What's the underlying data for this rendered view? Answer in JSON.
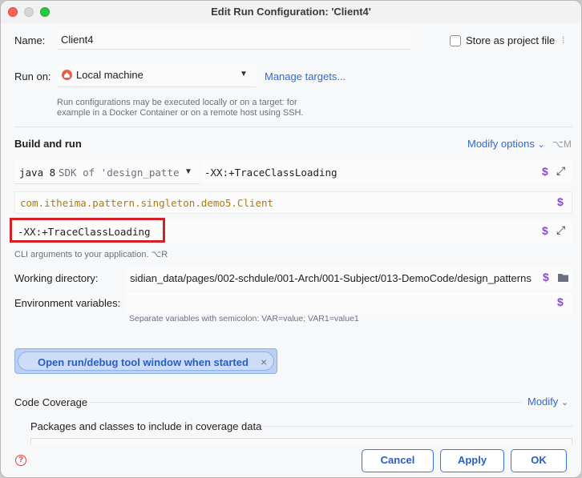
{
  "window": {
    "title": "Edit Run Configuration: 'Client4'"
  },
  "name_row": {
    "label": "Name:",
    "value": "Client4",
    "store_label": "Store as project file"
  },
  "run_on": {
    "label": "Run on:",
    "value": "Local machine",
    "manage_link": "Manage targets...",
    "help_line1": "Run configurations may be executed locally or on a target: for",
    "help_line2": "example in a Docker Container or on a remote host using SSH."
  },
  "build": {
    "heading": "Build and run",
    "modify_options": "Modify options",
    "modify_shortcut": "⌥M",
    "jdk_java": "java 8",
    "jdk_sdk": "SDK of 'design_pattern",
    "vm_options": "-XX:+TraceClassLoading",
    "main_class": "com.itheima.pattern.singleton.demo5.Client",
    "program_args": "-XX:+TraceClassLoading",
    "cli_hint": "CLI arguments to your application. ⌥R"
  },
  "working_dir": {
    "label": "Working directory:",
    "value": "sidian_data/pages/002-schdule/001-Arch/001-Subject/013-DemoCode/design_patterns"
  },
  "env": {
    "label": "Environment variables:",
    "hint": "Separate variables with semicolon: VAR=value; VAR1=value1"
  },
  "open_tool_window": {
    "label": "Open run/debug tool window when started",
    "close": "×"
  },
  "coverage": {
    "label": "Code Coverage",
    "modify": "Modify",
    "packages_label": "Packages and classes to include in coverage data"
  },
  "buttons": {
    "cancel": "Cancel",
    "apply": "Apply",
    "ok": "OK"
  },
  "icons": {
    "dollar": "$",
    "expand": "⤢",
    "chevron": "⌄",
    "help": "?",
    "folder": "folder-icon"
  },
  "colors": {
    "accent": "#3574f0",
    "highlight_border": "#d41f24",
    "macro": "#8a4bc6",
    "main_class": "#b07a0b"
  }
}
